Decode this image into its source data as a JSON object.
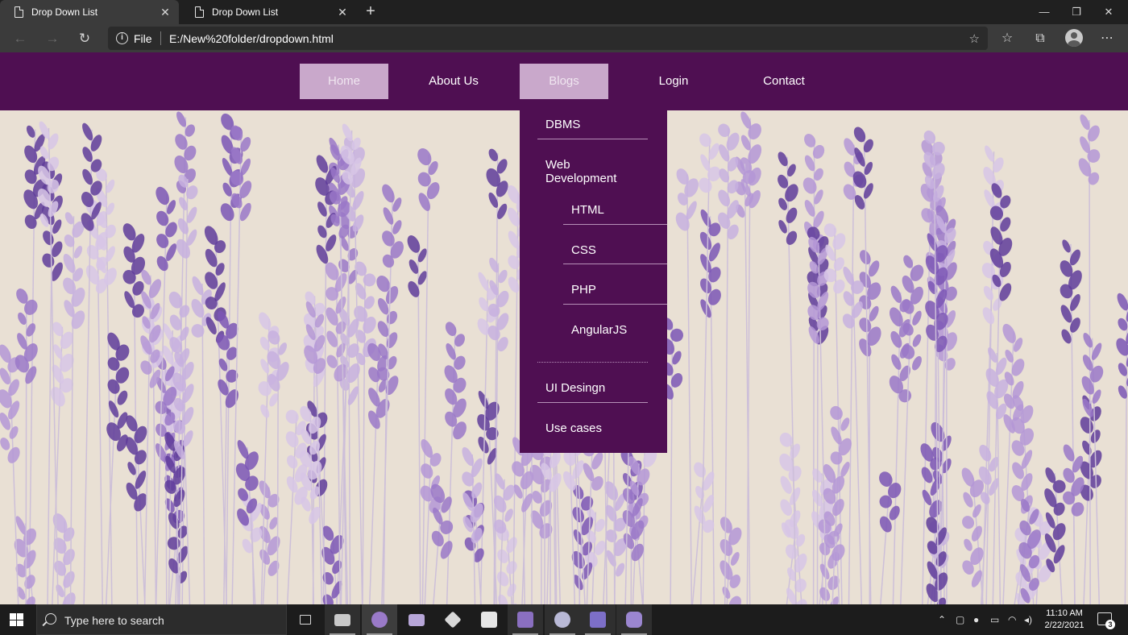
{
  "browser": {
    "tabs": [
      {
        "title": "Drop Down List",
        "active": true
      },
      {
        "title": "Drop Down List",
        "active": false
      }
    ],
    "address": {
      "scheme_label": "File",
      "url": "E:/New%20folder/dropdown.html"
    }
  },
  "page": {
    "navbar": {
      "items": [
        {
          "label": "Home",
          "highlighted": true
        },
        {
          "label": "About Us",
          "highlighted": false
        },
        {
          "label": "Blogs",
          "highlighted": true
        },
        {
          "label": "Login",
          "highlighted": false
        },
        {
          "label": "Contact",
          "highlighted": false
        }
      ]
    },
    "dropdown": {
      "items": [
        {
          "label": "DBMS"
        },
        {
          "label": "Web Development",
          "sub_items": [
            "HTML",
            "CSS",
            "PHP",
            "AngularJS"
          ]
        },
        {
          "label": "UI Desingn"
        },
        {
          "label": "Use cases"
        }
      ]
    },
    "colors": {
      "nav_bg": "#4f0f52",
      "highlight": "#c9a8cb",
      "bg": "#e9e0d4",
      "lavender": "#7b56b5"
    }
  },
  "taskbar": {
    "search_placeholder": "Type here to search",
    "clock_time": "11:10 AM",
    "clock_date": "2/22/2021",
    "notification_count": "3"
  }
}
